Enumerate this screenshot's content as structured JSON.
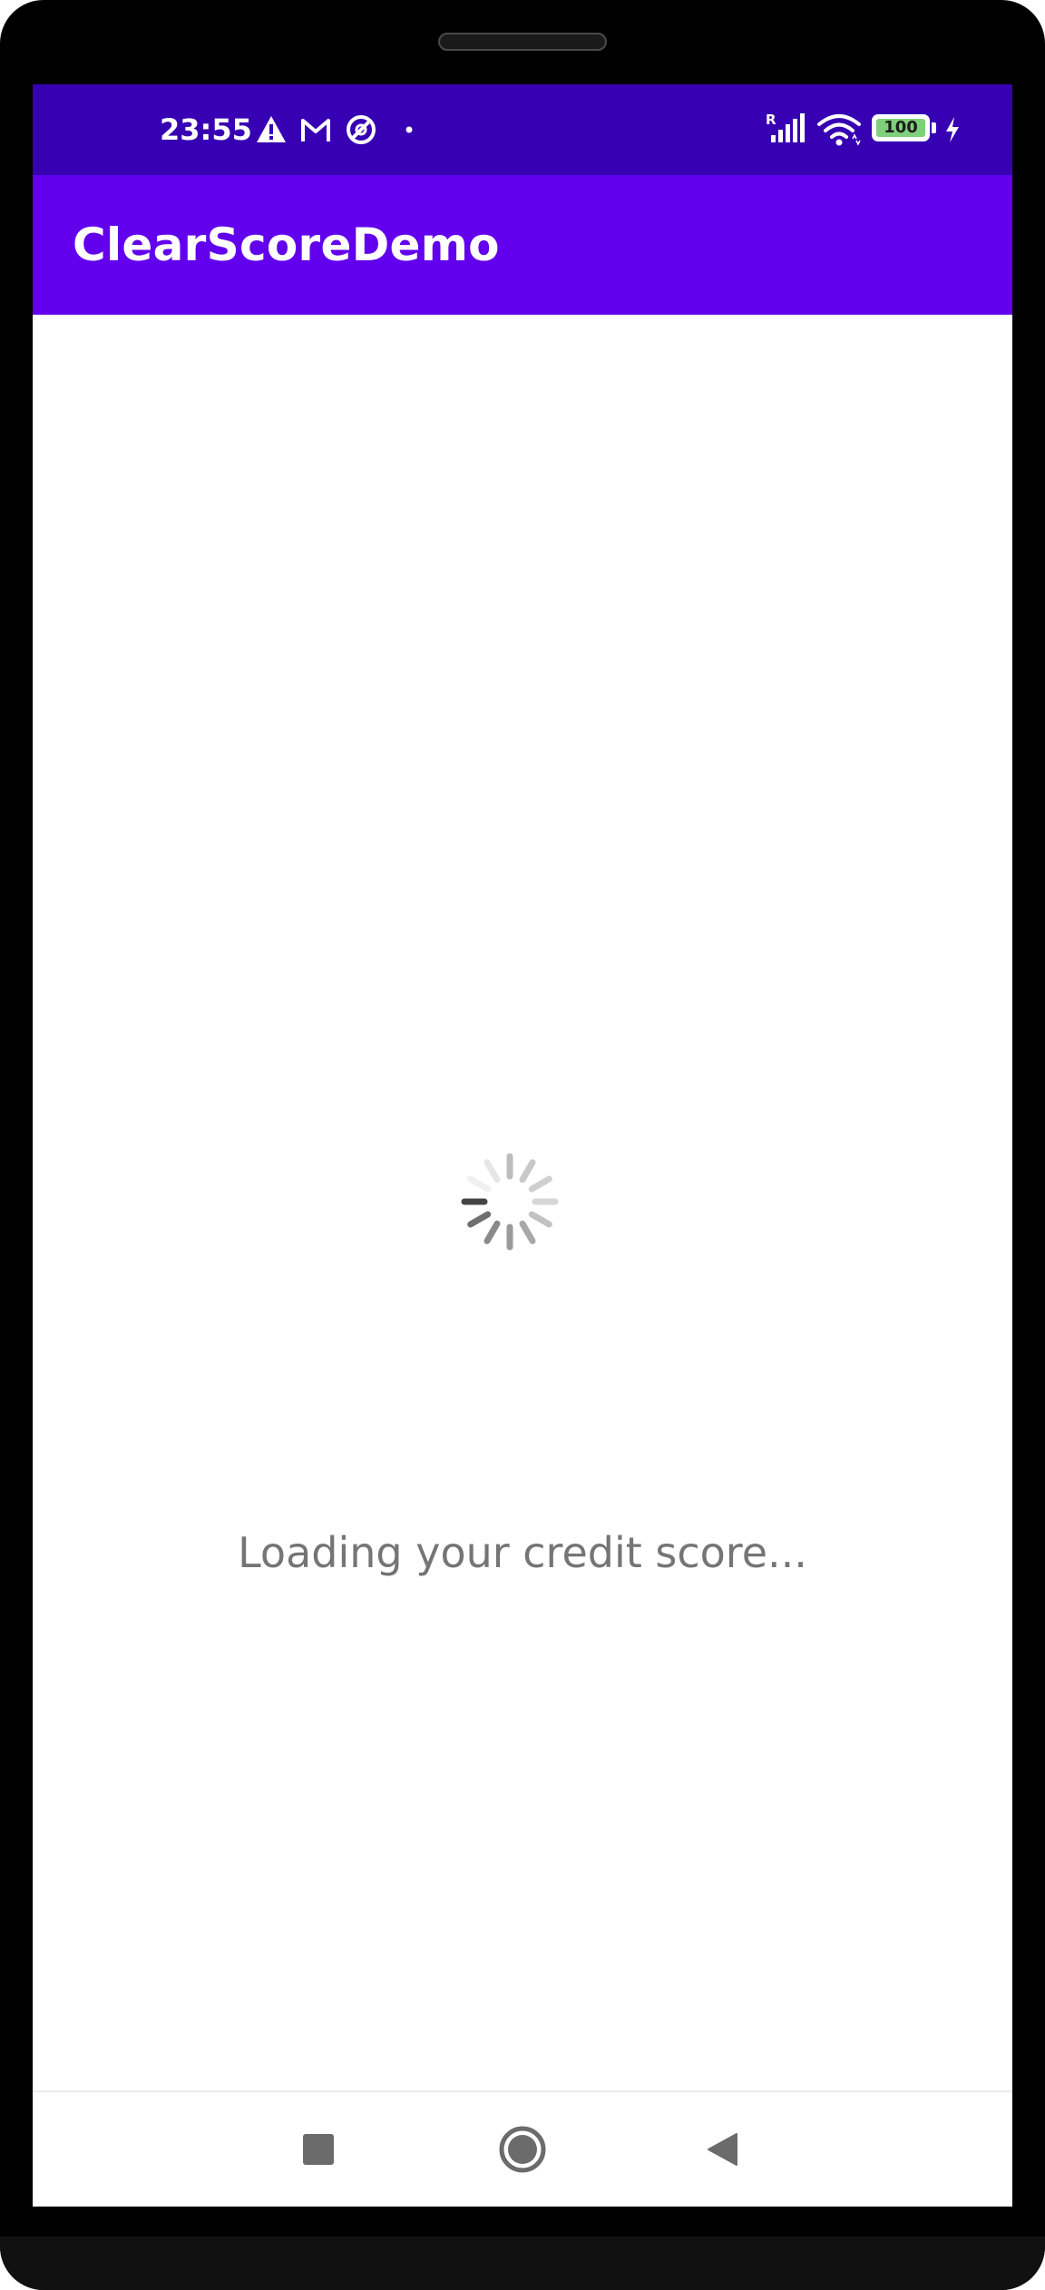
{
  "status_bar": {
    "time": "23:55",
    "left_icons": [
      "warning-icon",
      "gmail-icon",
      "no-data-saver-icon",
      "notification-dot-icon"
    ],
    "right_icons": [
      "signal-roaming-icon",
      "wifi-icon",
      "battery-icon",
      "charging-bolt-icon"
    ],
    "signal_roaming_label": "R",
    "battery_level": "100",
    "colors": {
      "background": "#3700B3",
      "battery_fill": "#7fd07a"
    }
  },
  "app_bar": {
    "title": "ClearScoreDemo",
    "background": "#6200EE"
  },
  "main": {
    "spinner": "loading-spinner-icon",
    "loading_text": "Loading your credit score..."
  },
  "nav_bar": {
    "buttons": [
      "recents-square-icon",
      "home-circle-icon",
      "back-triangle-icon"
    ]
  }
}
